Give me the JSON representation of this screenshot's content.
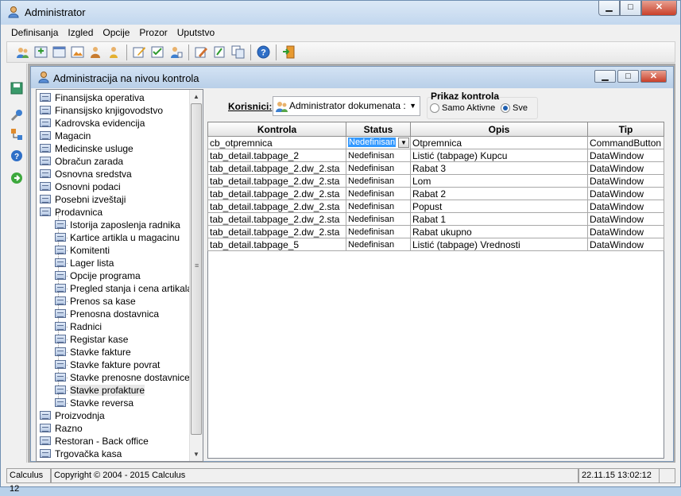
{
  "window": {
    "title": "Administrator",
    "buttons": {
      "minimize": "▁",
      "maximize": "□",
      "close": "✕"
    }
  },
  "menu": [
    "Definisanja",
    "Izgled",
    "Opcije",
    "Prozor",
    "Uputstvo"
  ],
  "toolbar_icons": [
    "users-icon",
    "add-icon",
    "window-icon",
    "image-icon",
    "group-icon",
    "user-icon",
    "edit-icon",
    "checklist-icon",
    "user-edit-icon",
    "pencil-icon",
    "report-icon",
    "copy-icon",
    "help-icon",
    "exit-icon"
  ],
  "leftbar_icons": [
    "save-icon",
    "tools-icon",
    "network-icon",
    "help-icon",
    "forward-icon"
  ],
  "child": {
    "title": "Administracija na nivou kontrola",
    "buttons": {
      "minimize": "▁",
      "maximize": "□",
      "close": "✕"
    }
  },
  "tree": {
    "top": [
      "Finansijska operativa",
      "Finansijsko knjigovodstvo",
      "Kadrovska evidencija",
      "Magacin",
      "Medicinske usluge",
      "Obračun zarada",
      "Osnovna sredstva",
      "Osnovni podaci",
      "Posebni izveštaji",
      "Prodavnica"
    ],
    "children": [
      "Istorija zaposlenja radnika",
      "Kartice artikla u magacinu",
      "Komitenti",
      "Lager lista",
      "Opcije programa",
      "Pregled stanja i cena artikala",
      "Prenos sa kase",
      "Prenosna dostavnica",
      "Radnici",
      "Registar kase",
      "Stavke fakture",
      "Stavke fakture povrat",
      "Stavke prenosne dostavnice",
      "Stavke profakture",
      "Stavke reversa"
    ],
    "bottom": [
      "Proizvodnja",
      "Razno",
      "Restoran - Back office",
      "Trgovačka kasa"
    ],
    "selected": "Stavke profakture",
    "scroll_up": "▲",
    "scroll_down": "▼",
    "scroll_grip": "≡"
  },
  "korisnici": {
    "label": "Korisnici:",
    "value": "Administrator dokumenata :",
    "dropdown": "▼"
  },
  "prikaz": {
    "legend": "Prikaz kontrola",
    "options": [
      "Samo Aktivne",
      "Sve"
    ],
    "selected": "Sve"
  },
  "grid": {
    "columns": [
      "Kontrola",
      "Status",
      "Opis",
      "Tip"
    ],
    "rows": [
      [
        "cb_otpremnica",
        "Nedefinisan",
        "Otpremnica",
        "CommandButton"
      ],
      [
        "tab_detail.tabpage_2",
        "Nedefinisan",
        "Listić (tabpage) Kupcu",
        "DataWindow"
      ],
      [
        "tab_detail.tabpage_2.dw_2.sta",
        "Nedefinisan",
        "Rabat 3",
        "DataWindow"
      ],
      [
        "tab_detail.tabpage_2.dw_2.sta",
        "Nedefinisan",
        "Lom",
        "DataWindow"
      ],
      [
        "tab_detail.tabpage_2.dw_2.sta",
        "Nedefinisan",
        "Rabat 2",
        "DataWindow"
      ],
      [
        "tab_detail.tabpage_2.dw_2.sta",
        "Nedefinisan",
        "Popust",
        "DataWindow"
      ],
      [
        "tab_detail.tabpage_2.dw_2.sta",
        "Nedefinisan",
        "Rabat 1",
        "DataWindow"
      ],
      [
        "tab_detail.tabpage_2.dw_2.sta",
        "Nedefinisan",
        "Rabat ukupno",
        "DataWindow"
      ],
      [
        "tab_detail.tabpage_5",
        "Nedefinisan",
        "Listić (tabpage) Vrednosti",
        "DataWindow"
      ]
    ],
    "active_cell_dropdown": "▼"
  },
  "statusbar": {
    "app": "Calculus 12",
    "copyright": "Copyright © 2004 - 2015  Calculus",
    "datetime": "22.11.15 13:02:12"
  }
}
